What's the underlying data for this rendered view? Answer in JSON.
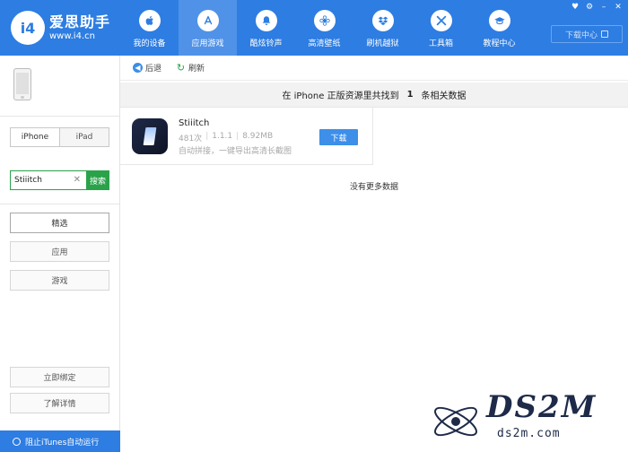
{
  "header": {
    "logo_badge": "i4",
    "logo_name": "爱思助手",
    "logo_url": "www.i4.cn",
    "nav": [
      {
        "label": "我的设备",
        "icon": "apple-icon",
        "active": false
      },
      {
        "label": "应用游戏",
        "icon": "app-store-icon",
        "active": true
      },
      {
        "label": "酷炫铃声",
        "icon": "bell-icon",
        "active": false
      },
      {
        "label": "高清壁纸",
        "icon": "flower-icon",
        "active": false
      },
      {
        "label": "刷机越狱",
        "icon": "dropbox-icon",
        "active": false
      },
      {
        "label": "工具箱",
        "icon": "tools-icon",
        "active": false
      },
      {
        "label": "教程中心",
        "icon": "graduation-cap-icon",
        "active": false
      }
    ],
    "download_center": "下载中心",
    "accent_color": "#2d7de2"
  },
  "sidebar": {
    "device_tabs": [
      "iPhone",
      "iPad"
    ],
    "search": {
      "value": "Stiiitch",
      "button": "搜索"
    },
    "categories": [
      "精选",
      "应用",
      "游戏"
    ],
    "bind_now": "立即绑定",
    "learn_more": "了解详情",
    "footer": "阻止iTunes自动运行"
  },
  "toolbar": {
    "back": "后退",
    "refresh": "刷新"
  },
  "results": {
    "prefix": "在 iPhone 正版资源里共找到",
    "count": "1",
    "suffix": "条相关数据"
  },
  "app": {
    "name": "Stiiitch",
    "downloads": "481次",
    "version": "1.1.1",
    "size": "8.92MB",
    "description": "自动拼接，一键导出高清长截图",
    "download_button": "下载"
  },
  "no_more": "没有更多数据",
  "watermark": {
    "text": "DS2M",
    "sub": "ds2m.com"
  }
}
